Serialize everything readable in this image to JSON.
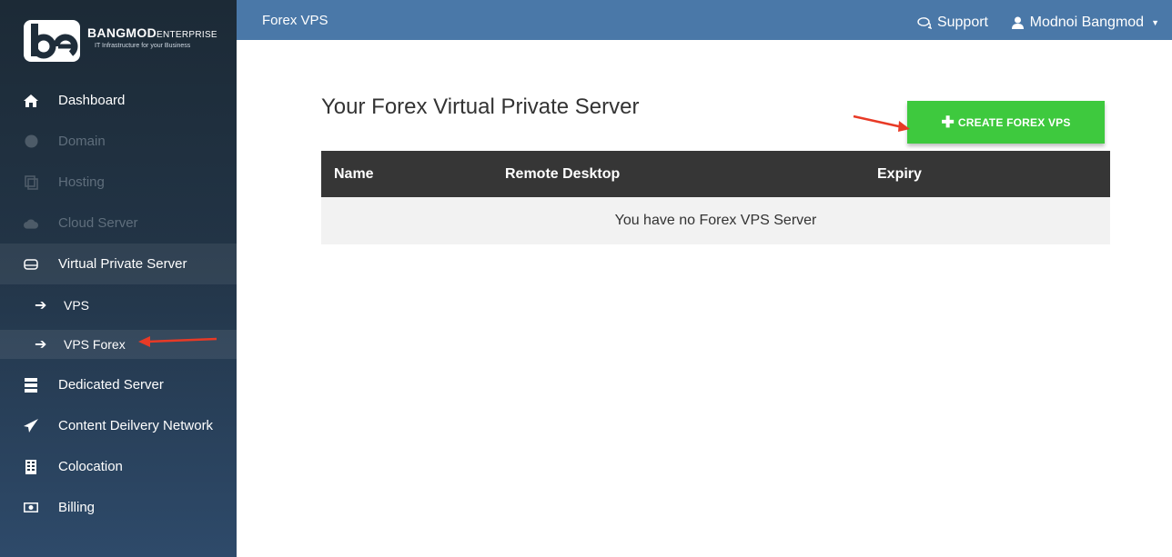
{
  "brand": {
    "name_bold": "BANGMOD",
    "name_small": "ENTERPRISE",
    "tagline": "IT Infrastructure for your Business",
    "accent": "#ffffff"
  },
  "sidebar": {
    "items": [
      {
        "label": "Dashboard",
        "icon": "home-icon",
        "state": "enabled"
      },
      {
        "label": "Domain",
        "icon": "globe-icon",
        "state": "disabled"
      },
      {
        "label": "Hosting",
        "icon": "copy-icon",
        "state": "disabled"
      },
      {
        "label": "Cloud Server",
        "icon": "cloud-icon",
        "state": "disabled"
      },
      {
        "label": "Virtual Private Server",
        "icon": "hdd-icon",
        "state": "section-open"
      },
      {
        "label": "Dedicated Server",
        "icon": "server-icon",
        "state": "enabled"
      },
      {
        "label": "Content Deilvery Network",
        "icon": "send-icon",
        "state": "enabled"
      },
      {
        "label": "Colocation",
        "icon": "building-icon",
        "state": "enabled"
      },
      {
        "label": "Billing",
        "icon": "money-icon",
        "state": "enabled"
      }
    ],
    "subitems": [
      {
        "label": "VPS",
        "icon": "arrow-right-icon"
      },
      {
        "label": "VPS Forex",
        "icon": "arrow-right-icon",
        "active": true
      }
    ]
  },
  "topbar": {
    "title": "Forex VPS",
    "support_label": "Support",
    "user_name": "Modnoi Bangmod",
    "background": "#4a78a8"
  },
  "main": {
    "heading": "Your Forex Virtual Private Server",
    "create_button_label": "CREATE FOREX VPS",
    "create_button_color": "#3ec93e",
    "table": {
      "columns": [
        "Name",
        "Remote Desktop",
        "Expiry"
      ],
      "empty_message": "You have no Forex VPS Server"
    }
  },
  "annotation_arrow_color": "#e83a26"
}
